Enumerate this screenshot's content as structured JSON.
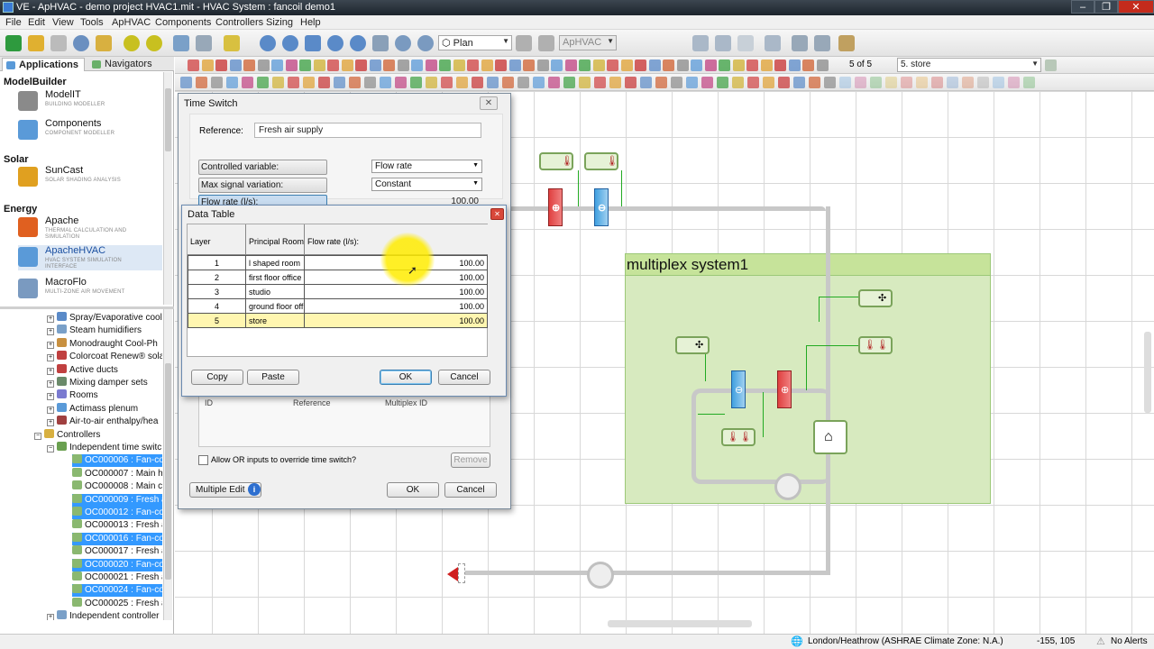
{
  "window": {
    "title": "VE - ApHVAC - demo project HVAC1.mit - HVAC System : fancoil demo1"
  },
  "menu": [
    "File",
    "Edit",
    "View",
    "Tools",
    "ApHVAC",
    "Components",
    "Controllers",
    "Sizing",
    "Help"
  ],
  "toolbar": {
    "view_mode": "Plan",
    "module": "ApHVAC",
    "layer_counter": "5 of 5",
    "layer_select": "5. store"
  },
  "left_tabs": {
    "applications": "Applications",
    "navigators": "Navigators"
  },
  "apps": {
    "sections": [
      {
        "name": "ModelBuilder",
        "items": [
          {
            "name": "ModelIT",
            "sub": "BUILDING MODELLER"
          },
          {
            "name": "Components",
            "sub": "COMPONENT MODELLER"
          }
        ]
      },
      {
        "name": "Solar",
        "items": [
          {
            "name": "SunCast",
            "sub": "SOLAR SHADING ANALYSIS"
          }
        ]
      },
      {
        "name": "Energy",
        "items": [
          {
            "name": "Apache",
            "sub": "THERMAL CALCULATION AND SIMULATION"
          },
          {
            "name": "ApacheHVAC",
            "sub": "HVAC SYSTEM SIMULATION INTERFACE"
          },
          {
            "name": "MacroFlo",
            "sub": "MULTI-ZONE AIR MOVEMENT"
          }
        ]
      }
    ]
  },
  "tree": [
    {
      "label": "Spray/Evaporative cool",
      "indent": 1,
      "sel": false
    },
    {
      "label": "Steam humidifiers",
      "indent": 1,
      "sel": false
    },
    {
      "label": "Monodraught Cool-Ph",
      "indent": 1,
      "sel": false
    },
    {
      "label": "Colorcoat Renew® sola",
      "indent": 1,
      "sel": false
    },
    {
      "label": "Active ducts",
      "indent": 1,
      "sel": false
    },
    {
      "label": "Mixing damper sets",
      "indent": 1,
      "sel": false
    },
    {
      "label": "Rooms",
      "indent": 1,
      "sel": false
    },
    {
      "label": "Actimass plenum",
      "indent": 1,
      "sel": false
    },
    {
      "label": "Air-to-air enthalpy/hea",
      "indent": 1,
      "sel": false
    },
    {
      "label": "Controllers",
      "indent": 0,
      "sel": false
    },
    {
      "label": "Independent time switc",
      "indent": 1,
      "sel": false
    },
    {
      "label": "OC000006 : Fan-coi",
      "indent": 2,
      "sel": true
    },
    {
      "label": "OC000007 : Main he",
      "indent": 2,
      "sel": false
    },
    {
      "label": "OC000008 : Main co",
      "indent": 2,
      "sel": false
    },
    {
      "label": "OC000009 : Fresh ai",
      "indent": 2,
      "sel": true
    },
    {
      "label": "OC000012 : Fan-coi",
      "indent": 2,
      "sel": true
    },
    {
      "label": "OC000013 : Fresh ai",
      "indent": 2,
      "sel": false
    },
    {
      "label": "OC000016 : Fan-coi",
      "indent": 2,
      "sel": true
    },
    {
      "label": "OC000017 : Fresh ai",
      "indent": 2,
      "sel": false
    },
    {
      "label": "OC000020 : Fan-coi",
      "indent": 2,
      "sel": true
    },
    {
      "label": "OC000021 : Fresh ai",
      "indent": 2,
      "sel": false
    },
    {
      "label": "OC000024 : Fan-coi",
      "indent": 2,
      "sel": true
    },
    {
      "label": "OC000025 : Fresh ai",
      "indent": 2,
      "sel": false
    },
    {
      "label": "Independent controller",
      "indent": 1,
      "sel": false
    }
  ],
  "time_switch": {
    "title": "Time Switch",
    "reference_label": "Reference:",
    "reference_value": "Fresh air supply",
    "controlled_variable_label": "Controlled variable:",
    "controlled_variable_value": "Flow rate",
    "max_signal_label": "Max signal variation:",
    "max_signal_value": "Constant",
    "flow_rate_label": "Flow rate (l/s):",
    "flow_rate_value": "100.00",
    "col_id": "ID",
    "col_reference": "Reference",
    "col_multiplex": "Multiplex ID",
    "allow_or": "Allow OR inputs to override time switch?",
    "remove": "Remove",
    "multiple_edit": "Multiple Edit",
    "ok": "OK",
    "cancel": "Cancel"
  },
  "data_table": {
    "title": "Data Table",
    "headers": [
      "Layer",
      "Principal Room",
      "Flow rate (l/s):"
    ],
    "rows": [
      {
        "layer": "1",
        "room": "l shaped room",
        "flow": "100.00",
        "highlight": false
      },
      {
        "layer": "2",
        "room": "first floor office",
        "flow": "100.00",
        "highlight": false
      },
      {
        "layer": "3",
        "room": "studio",
        "flow": "100.00",
        "highlight": false
      },
      {
        "layer": "4",
        "room": "ground floor off",
        "flow": "100.00",
        "highlight": false
      },
      {
        "layer": "5",
        "room": "store",
        "flow": "100.00",
        "highlight": true
      }
    ],
    "copy": "Copy",
    "paste": "Paste",
    "ok": "OK",
    "cancel": "Cancel"
  },
  "canvas": {
    "multiplex_label": "multiplex system1"
  },
  "status": {
    "location": "London/Heathrow (ASHRAE Climate Zone: N.A.)",
    "coords": "-155, 105",
    "alerts": "No Alerts"
  },
  "colors": {
    "accent": "#3399ff",
    "multiplex_fill": "#d7eabf",
    "multiplex_header": "#c6e39a",
    "highlight_row": "#fff6b0",
    "cursor_halo": "#ffe600"
  }
}
